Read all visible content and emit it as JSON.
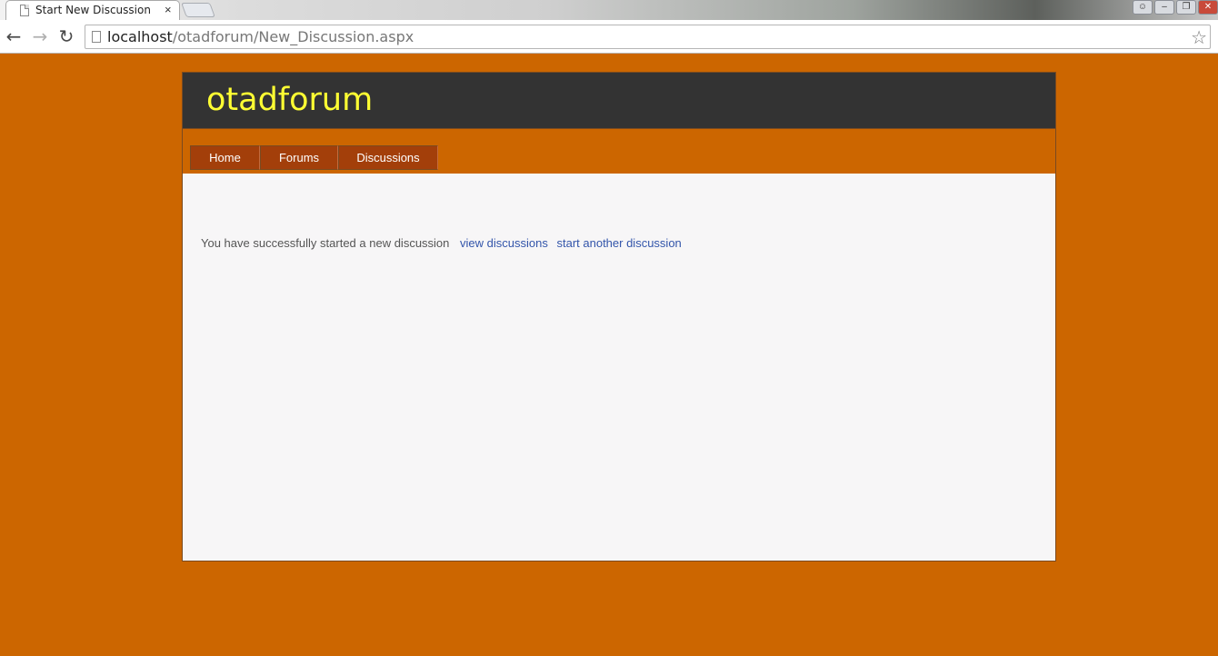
{
  "browser": {
    "tab_title": "Start New Discussion",
    "tab_close": "×",
    "url_host": "localhost",
    "url_path": "/otadforum/New_Discussion.aspx",
    "back_icon": "back-arrow-icon",
    "forward_icon": "forward-arrow-icon",
    "reload_icon": "reload-icon",
    "bookmark_icon": "star-icon"
  },
  "site": {
    "logo": "otadforum",
    "colors": {
      "background": "#cc6600",
      "header": "#333333",
      "logo": "#ffff33",
      "menu_item": "#a33f0a",
      "link": "#3355aa"
    }
  },
  "menu": {
    "items": [
      {
        "label": "Home"
      },
      {
        "label": "Forums"
      },
      {
        "label": "Discussions"
      }
    ]
  },
  "content": {
    "message": "You have successfully started a new discussion",
    "view_link": "view discussions",
    "start_link": "start another discussion"
  }
}
